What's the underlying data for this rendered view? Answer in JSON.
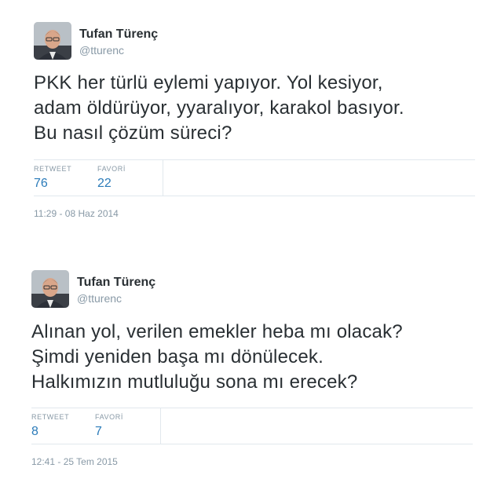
{
  "tweets": [
    {
      "author": {
        "name": "Tufan Türenç",
        "handle": "@tturenc",
        "avatar_icon": "person-photo-icon"
      },
      "text_lines": [
        "PKK her türlü eylemi yapıyor. Yol kesiyor,",
        "adam öldürüyor, yyaralıyor, karakol basıyor.",
        "Bu nasıl çözüm süreci?"
      ],
      "stats": {
        "retweet_label": "RETWEET",
        "retweet_count": "76",
        "favorite_label": "FAVORİ",
        "favorite_count": "22"
      },
      "timestamp": "11:29 - 08 Haz 2014"
    },
    {
      "author": {
        "name": "Tufan Türenç",
        "handle": "@tturenc",
        "avatar_icon": "person-photo-icon"
      },
      "text_lines": [
        "Alınan yol, verilen emekler heba mı olacak?",
        "Şimdi yeniden başa mı dönülecek.",
        "Halkımızın mutluluğu sona mı erecek?"
      ],
      "stats": {
        "retweet_label": "RETWEET",
        "retweet_count": "8",
        "favorite_label": "FAVORİ",
        "favorite_count": "7"
      },
      "timestamp": "12:41 - 25 Tem 2015"
    }
  ],
  "colors": {
    "link_blue": "#2b7bb9",
    "muted_gray": "#8899a6",
    "text_dark": "#292f33",
    "divider": "#e1e8ed"
  }
}
